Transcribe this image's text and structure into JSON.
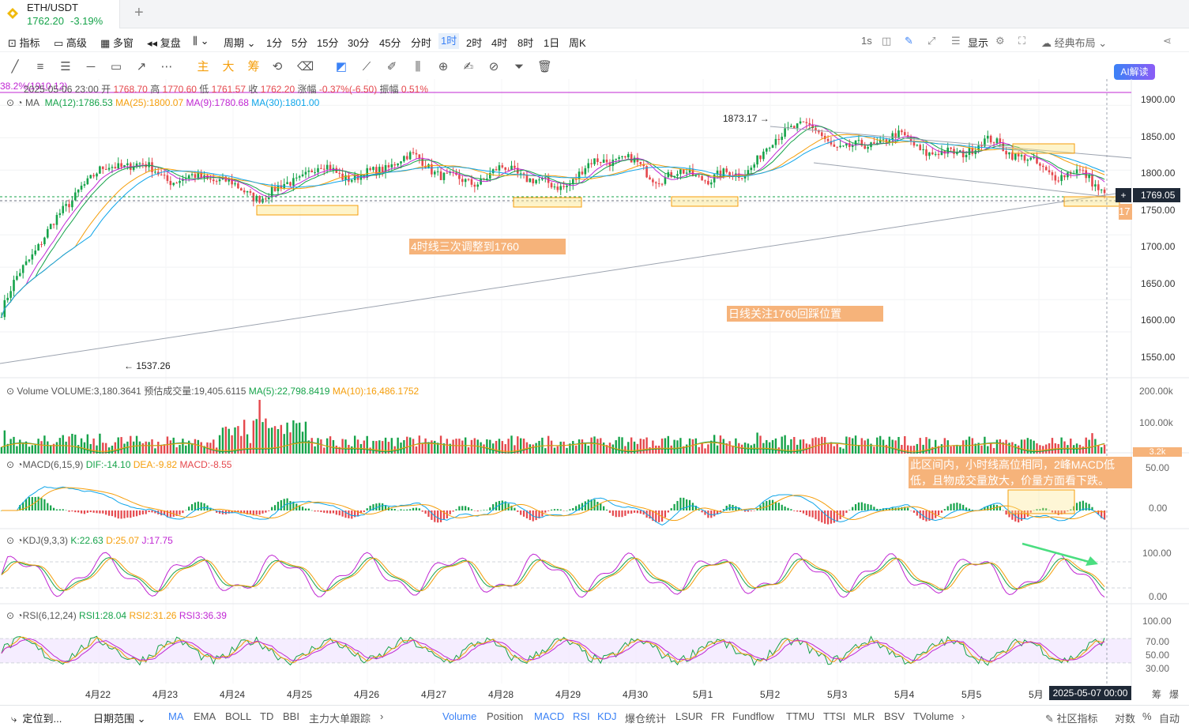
{
  "tab": {
    "symbol": "ETH/USDT",
    "price": "1762.20",
    "change": "-3.19%"
  },
  "toolbar": {
    "left": [
      "指标",
      "高级",
      "多窗",
      "复盘",
      "周期"
    ],
    "intervals": [
      "1分",
      "5分",
      "15分",
      "30分",
      "45分",
      "分时",
      "1时",
      "2时",
      "4时",
      "8时",
      "1日",
      "周K"
    ],
    "selected_interval": "1时",
    "right": [
      "1s",
      "显示",
      "经典布局"
    ],
    "ai_button": "AI解读"
  },
  "drawbar": {
    "labels": [
      "主",
      "大",
      "筹"
    ]
  },
  "ohlc": {
    "fib_tag": "38.2%(1910.12)",
    "date": "2025-05-06 23:00",
    "open_label": "开",
    "open": "1768.70",
    "high_label": "高",
    "high": "1770.60",
    "low_label": "低",
    "low": "1761.57",
    "close_label": "收",
    "close": "1762.20",
    "change_label": "涨幅",
    "change": "-0.37%(-6.50)",
    "amp_label": "振幅",
    "amp": "0.51%"
  },
  "ma_legend": {
    "name": "MA",
    "ma12": "MA(12):1786.53",
    "ma25": "MA(25):1800.07",
    "ma9": "MA(9):1780.68",
    "ma30": "MA(30):1801.00"
  },
  "price_axis": [
    "1900.00",
    "1850.00",
    "1800.00",
    "1750.00",
    "1700.00",
    "1650.00",
    "1600.00",
    "1550.00"
  ],
  "current_price_tag": "1769.05",
  "price_partial": "17",
  "high_marker": "1873.17",
  "low_marker": "1537.26",
  "annotations": {
    "a1": "4时线三次调整到1760",
    "a2": "日线关注1760回踩位置",
    "a3_line1": "此区间内，小时线高位相同，2峰MACD低",
    "a3_line2": "低，且物成交量放大，价量方面看下跌。"
  },
  "volume": {
    "name": "Volume",
    "vol": "VOLUME:3,180.3641",
    "est": "预估成交量:19,405.6115",
    "ma5": "MA(5):22,798.8419",
    "ma10": "MA(10):16,486.1752",
    "axis": [
      "200.00k",
      "100.00k"
    ],
    "tag": "3.2k"
  },
  "macd": {
    "name": "MACD(6,15,9)",
    "dif": "DIF:-14.10",
    "dea": "DEA:-9.82",
    "macd": "MACD:-8.55",
    "axis": [
      "50.00",
      "0.00"
    ]
  },
  "kdj": {
    "name": "KDJ(9,3,3)",
    "k": "K:22.63",
    "d": "D:25.07",
    "j": "J:17.75",
    "axis": [
      "100.00",
      "0.00"
    ]
  },
  "rsi": {
    "name": "RSI(6,12,24)",
    "r1": "RSI1:28.04",
    "r2": "RSI2:31.26",
    "r3": "RSI3:36.39",
    "axis": [
      "100.00",
      "70.00",
      "50.00",
      "30.00"
    ]
  },
  "dates": [
    "4月22",
    "4月23",
    "4月24",
    "4月25",
    "4月26",
    "4月27",
    "4月28",
    "4月29",
    "4月30",
    "5月1",
    "5月2",
    "5月3",
    "5月4",
    "5月5",
    "5月"
  ],
  "crosshair_date": "2025-05-07 00:00",
  "corner": [
    "筹",
    "爆"
  ],
  "bottom": {
    "locate": "定位到...",
    "range": "日期范围",
    "main_inds": [
      "MA",
      "EMA",
      "BOLL",
      "TD",
      "BBI",
      "主力大单跟踪"
    ],
    "sub_inds": [
      "Volume",
      "Position",
      "MACD",
      "RSI",
      "KDJ",
      "爆仓统计",
      "LSUR",
      "FR",
      "Fundflow",
      "TTMU",
      "TTSI",
      "MLR",
      "BSV",
      "TVolume"
    ],
    "active_sub": [
      "Volume",
      "MACD",
      "RSI",
      "KDJ"
    ],
    "community": "社区指标",
    "right": [
      "对数",
      "%",
      "自动"
    ]
  },
  "colors": {
    "up": "#16a34a",
    "down": "#e5484d",
    "accent": "#3b82f6",
    "annotation": "#f6b37a"
  },
  "chart_data": {
    "type": "candlestick",
    "pair": "ETH/USDT",
    "interval": "1H",
    "x": [
      "4月22",
      "4月23",
      "4月24",
      "4月25",
      "4月26",
      "4月27",
      "4月28",
      "4月29",
      "4月30",
      "5月1",
      "5月2",
      "5月3",
      "5月4",
      "5月5",
      "5月"
    ],
    "close_trend": [
      1580,
      1790,
      1805,
      1765,
      1790,
      1810,
      1790,
      1785,
      1815,
      1775,
      1860,
      1840,
      1835,
      1825,
      1762
    ],
    "ylim": [
      1510,
      1915
    ]
  }
}
